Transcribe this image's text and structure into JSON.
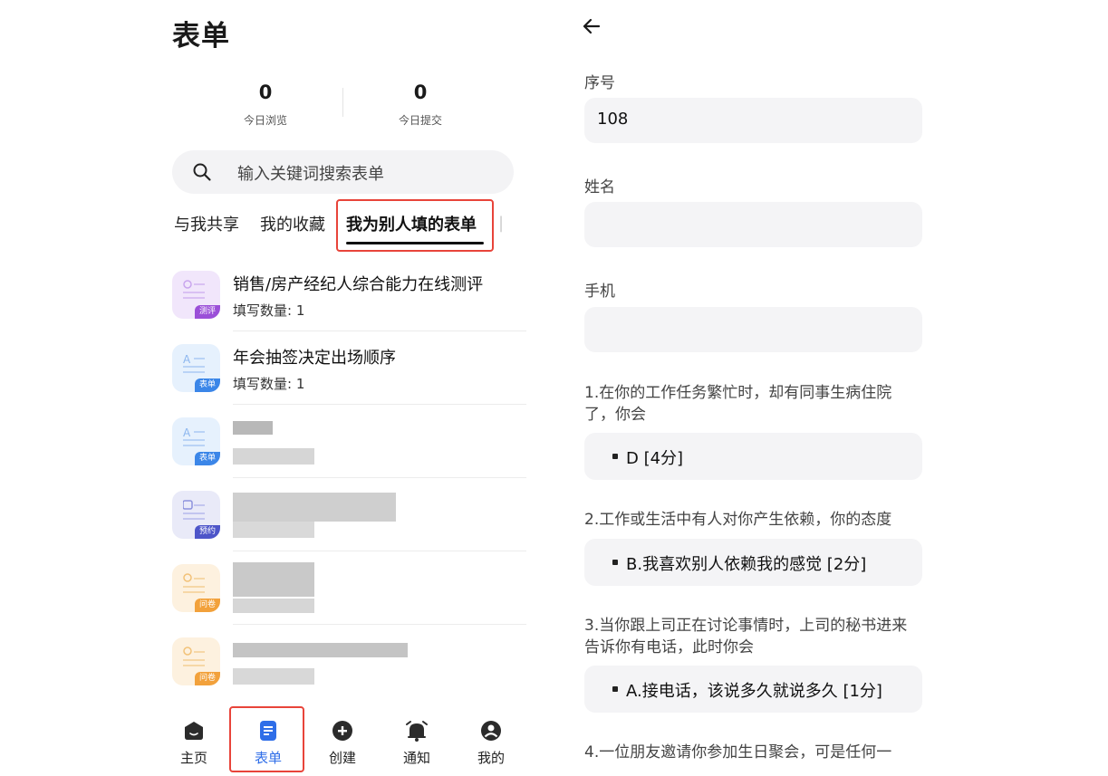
{
  "left": {
    "page_title": "表单",
    "stats": [
      {
        "value": "0",
        "label": "今日浏览"
      },
      {
        "value": "0",
        "label": "今日提交"
      }
    ],
    "search_placeholder": "输入关键词搜索表单",
    "tabs": [
      "与我共享",
      "我的收藏",
      "我为别人填的表单"
    ],
    "active_tab": "我为别人填的表单",
    "list": [
      {
        "title": "销售/房产经纪人综合能力在线测评",
        "sub": "填写数量: 1",
        "tag": "测评",
        "icon": "assessment-icon"
      },
      {
        "title": "年会抽签决定出场顺序",
        "sub": "填写数量: 1",
        "tag": "表单",
        "icon": "form-icon"
      },
      {
        "title": "",
        "sub": "",
        "tag": "表单",
        "icon": "form-icon"
      },
      {
        "title": "",
        "sub": "",
        "tag": "预约",
        "icon": "calendar-icon"
      },
      {
        "title": "",
        "sub": "",
        "tag": "问卷",
        "icon": "questionnaire-icon"
      },
      {
        "title": "",
        "sub": "",
        "tag": "问卷",
        "icon": "questionnaire-icon"
      }
    ],
    "bottom_nav": [
      {
        "label": "主页",
        "icon": "home-icon"
      },
      {
        "label": "表单",
        "icon": "form-doc-icon"
      },
      {
        "label": "创建",
        "icon": "plus-circle-icon"
      },
      {
        "label": "通知",
        "icon": "bell-icon"
      },
      {
        "label": "我的",
        "icon": "user-icon"
      }
    ],
    "active_nav": "表单"
  },
  "right": {
    "fields": [
      {
        "label": "序号",
        "value": "108"
      },
      {
        "label": "姓名",
        "value": ""
      },
      {
        "label": "手机",
        "value": ""
      }
    ],
    "questions": [
      {
        "text": "1.在你的工作任务繁忙时，却有同事生病住院了，你会",
        "answer": "D [4分]"
      },
      {
        "text": "2.工作或生活中有人对你产生依赖，你的态度",
        "answer": "B.我喜欢别人依赖我的感觉 [2分]"
      },
      {
        "text": "3.当你跟上司正在讨论事情时，上司的秘书进来告诉你有电话，此时你会",
        "answer": "A.接电话，该说多久就说多久 [1分]"
      },
      {
        "text": "4.一位朋友邀请你参加生日聚会，可是任何一",
        "answer": ""
      }
    ]
  },
  "colors": {
    "accent_blue": "#2f6ee8",
    "highlight_red": "#e8443a",
    "tag_assessment": "#9b4fd8",
    "tag_form": "#3b86e8",
    "tag_booking": "#4d55c9",
    "tag_questionnaire": "#f2a13b"
  }
}
